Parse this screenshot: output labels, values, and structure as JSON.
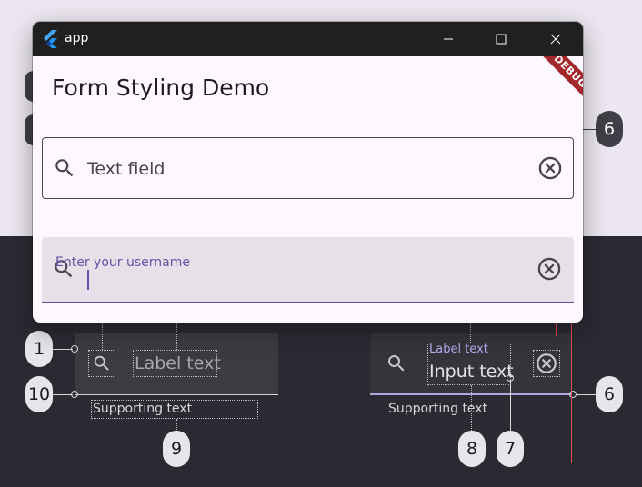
{
  "window": {
    "title": "app",
    "controls": {
      "minimize": "minimize",
      "maximize": "maximize",
      "close": "close"
    }
  },
  "page": {
    "title": "Form Styling Demo",
    "debug_banner": "DEBUG"
  },
  "fields": [
    {
      "placeholder": "Text field",
      "leading_icon": "search-icon",
      "trailing_icon": "clear-icon",
      "variant": "outlined"
    },
    {
      "label": "Enter your username",
      "value": "",
      "leading_icon": "search-icon",
      "trailing_icon": "clear-icon",
      "variant": "filled",
      "focused": true
    }
  ],
  "diagram": {
    "left_field": {
      "label": "Label text",
      "supporting": "Supporting text"
    },
    "right_field": {
      "label": "Label text",
      "input": "Input text",
      "supporting": "Supporting text"
    },
    "callouts": {
      "c1": "1",
      "c10": "10",
      "c9": "9",
      "c8": "8",
      "c7": "7",
      "c6_top": "6",
      "c6_bottom": "6"
    }
  },
  "colors": {
    "primary": "#6750a4",
    "surface": "#fdf8ff",
    "filled_bg": "#e6e0e9",
    "outline": "#49454f",
    "titlebar": "#202020",
    "debug": "#a3272b"
  }
}
